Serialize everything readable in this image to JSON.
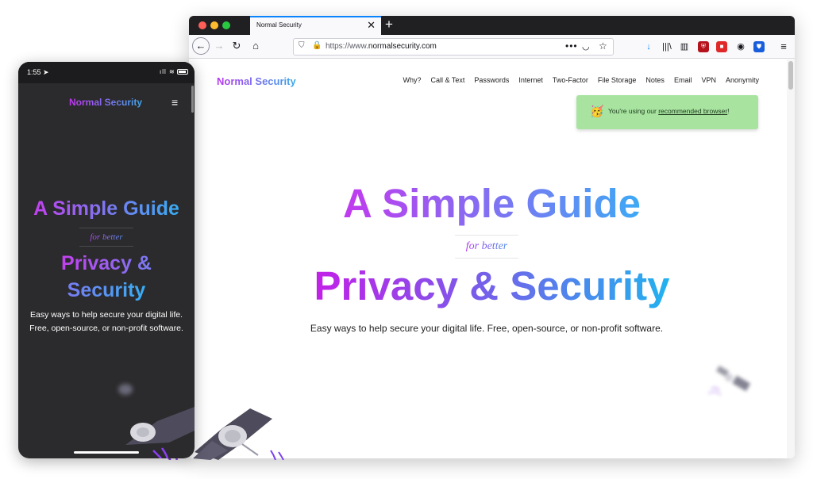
{
  "browser": {
    "tab_title": "Normal Security",
    "tab_close": "✕",
    "new_tab": "+",
    "url_prefix": "https://www.",
    "url_domain": "normalsecurity.com",
    "url_dots": "•••"
  },
  "site": {
    "brand": "Normal Security",
    "nav": [
      "Why?",
      "Call & Text",
      "Passwords",
      "Internet",
      "Two-Factor",
      "File Storage",
      "Notes",
      "Email",
      "VPN",
      "Anonymity"
    ],
    "toast": {
      "emoji": "🥳",
      "text": "You're using our ",
      "link": "recommended browser",
      "suffix": "!"
    },
    "hero": {
      "line1": "A Simple Guide",
      "sub": "for better",
      "line3": "Privacy & Security",
      "description": "Easy ways to help secure your digital life. Free, open-source, or non-profit software."
    }
  },
  "phone": {
    "time": "1:55",
    "brand": "Normal Security",
    "menu_icon": "≡",
    "hero": {
      "line1": "A Simple Guide",
      "sub": "for better",
      "line3": "Privacy & Security",
      "description": "Easy ways to help secure your digital life. Free, open-source, or non-profit software."
    }
  },
  "icons": {
    "back": "back-arrow-icon",
    "forward": "forward-arrow-icon",
    "reload": "reload-icon",
    "home": "home-icon",
    "download": "download-icon",
    "library": "library-icon",
    "sidebar": "sidebar-icon",
    "ublock": "ublock-icon",
    "extension": "extension-icon",
    "account": "account-icon",
    "bitwarden": "bitwarden-icon",
    "menu": "hamburger-menu-icon",
    "satellite": "satellite-icon"
  },
  "colors": {
    "gradient_start": "#c13aef",
    "gradient_end": "#3ea9f5",
    "toast_bg": "#a8e4a0",
    "phone_bg": "#2b2a2c",
    "tab_accent": "#0a84ff"
  }
}
